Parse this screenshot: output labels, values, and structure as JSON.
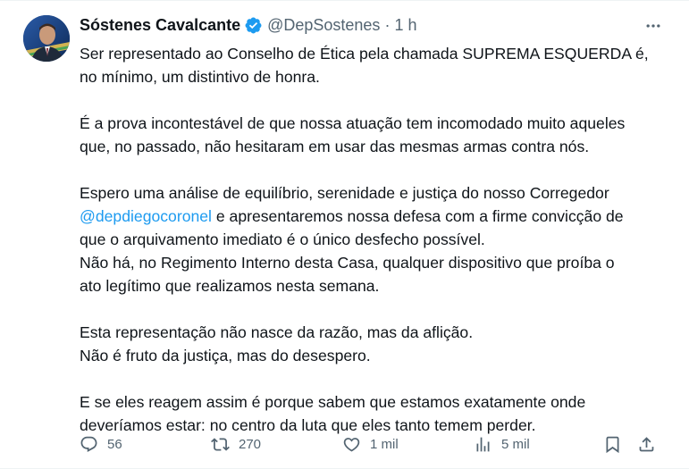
{
  "author": {
    "display_name": "Sóstenes Cavalcante",
    "handle": "@DepSostenes",
    "separator": "·",
    "time": "1 h",
    "avatar_icon": "profile-photo",
    "verified_icon": "verified-badge-icon",
    "verified_color": "#1d9bf0"
  },
  "tweet": {
    "p1_l1": "Ser representado ao Conselho de Ética pela chamada SUPREMA ESQUERDA é,",
    "p1_l2": "no mínimo, um distintivo de honra.",
    "p2_l1": "É a prova incontestável de que nossa atuação tem incomodado muito aqueles",
    "p2_l2": "que, no passado, não hesitaram em usar das mesmas armas contra nós.",
    "p3_l1": "Espero uma análise de equilíbrio, serenidade e justiça do nosso Corregedor",
    "p3_mention": "@depdiegocoronel",
    "p3_l2_rest": " e apresentaremos nossa defesa com a firme convicção de",
    "p3_l3": "que o arquivamento imediato é o único desfecho possível.",
    "p3_l4": "Não há, no Regimento Interno desta Casa, qualquer dispositivo que proíba o",
    "p3_l5": "ato legítimo que realizamos nesta semana.",
    "p4_l1": "Esta representação não nasce da razão, mas da aflição.",
    "p4_l2": "Não é fruto da justiça, mas do desespero.",
    "p5_l1": "E se eles reagem assim é porque sabem que estamos exatamente onde",
    "p5_l2": "deveríamos estar: no centro da luta que eles tanto temem perder.",
    "mention_color": "#1d9bf0"
  },
  "actions": {
    "replies": "56",
    "reposts": "270",
    "likes": "1 mil",
    "views": "5 mil",
    "icons": [
      "reply-icon",
      "repost-icon",
      "like-icon",
      "views-icon",
      "bookmark-icon",
      "share-icon"
    ],
    "icon_color": "#536471"
  },
  "menu": {
    "icon": "more-options-icon"
  }
}
